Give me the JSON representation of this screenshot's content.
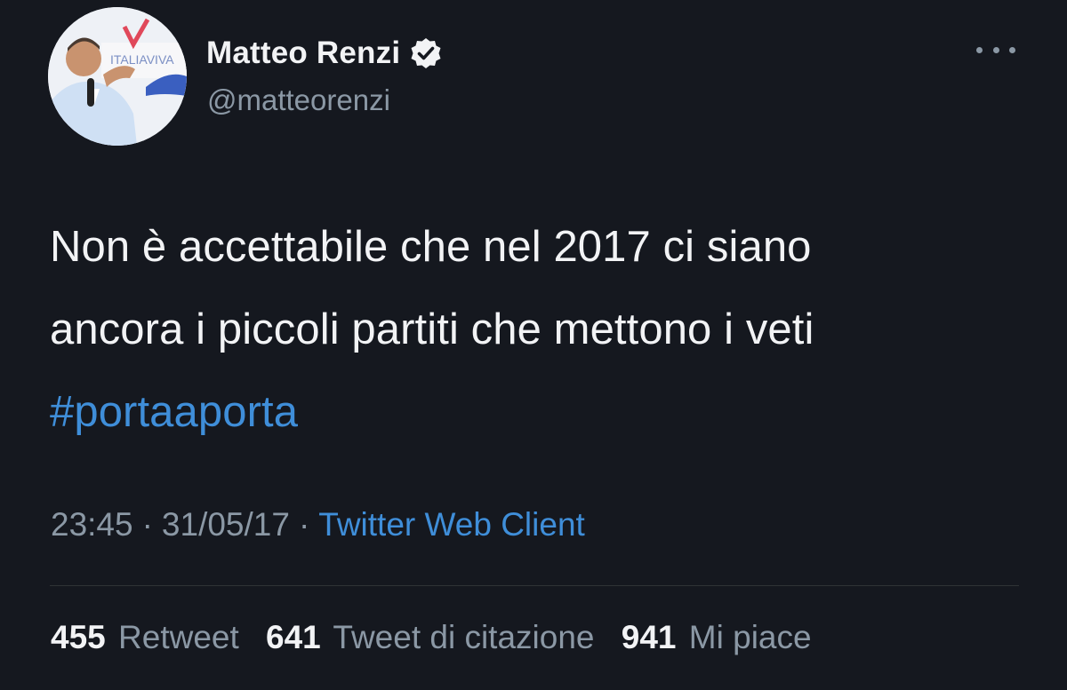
{
  "author": {
    "display_name": "Matteo Renzi",
    "handle": "@matteorenzi",
    "verified": true,
    "avatar_banner_text": "ITALIAVIVA"
  },
  "tweet": {
    "lines": [
      "Non è accettabile che nel 2017 ci siano",
      "ancora i piccoli partiti che mettono i veti"
    ],
    "hashtag": "#portaaporta",
    "time": "23:45",
    "date": "31/05/17",
    "separator": "·",
    "client": "Twitter Web Client"
  },
  "stats": {
    "retweets_count": "455",
    "retweets_label": "Retweet",
    "quotes_count": "641",
    "quotes_label": "Tweet di citazione",
    "likes_count": "941",
    "likes_label": "Mi piace"
  },
  "icons": {
    "verified": "verified-badge-icon",
    "more": "more-options-icon"
  },
  "colors": {
    "background": "#15181f",
    "link": "#3f8ed9",
    "secondary_text": "#8b98a5",
    "primary_text": "#f2f3f5"
  }
}
